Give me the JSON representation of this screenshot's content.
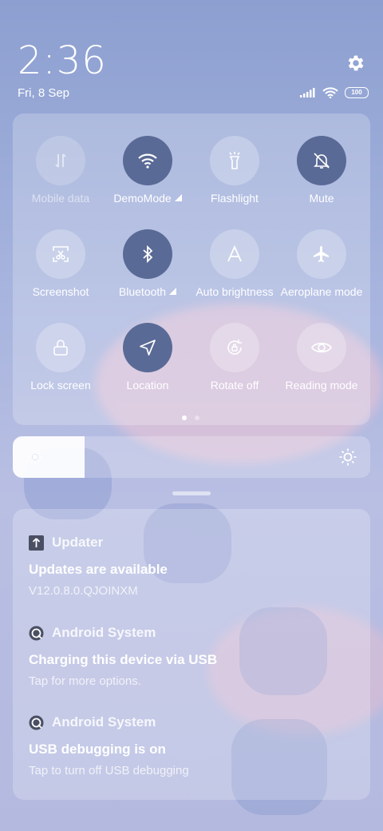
{
  "status": {
    "time": "2:36",
    "date": "Fri, 8 Sep",
    "battery": "100"
  },
  "tiles": [
    {
      "label": "Mobile data",
      "icon": "mobile-data-icon",
      "state": "disabled"
    },
    {
      "label": "DemoMode",
      "icon": "wifi-icon",
      "state": "active",
      "expandable": true
    },
    {
      "label": "Flashlight",
      "icon": "flashlight-icon",
      "state": "off"
    },
    {
      "label": "Mute",
      "icon": "bell-mute-icon",
      "state": "active"
    },
    {
      "label": "Screenshot",
      "icon": "screenshot-icon",
      "state": "off"
    },
    {
      "label": "Bluetooth",
      "icon": "bluetooth-icon",
      "state": "active",
      "expandable": true
    },
    {
      "label": "Auto brightness",
      "icon": "auto-brightness-icon",
      "state": "off"
    },
    {
      "label": "Aeroplane mode",
      "icon": "airplane-icon",
      "state": "off"
    },
    {
      "label": "Lock screen",
      "icon": "lock-icon",
      "state": "off"
    },
    {
      "label": "Location",
      "icon": "location-icon",
      "state": "active"
    },
    {
      "label": "Rotate off",
      "icon": "rotate-lock-icon",
      "state": "off"
    },
    {
      "label": "Reading mode",
      "icon": "eye-icon",
      "state": "off"
    }
  ],
  "pager": {
    "pages": 2,
    "current": 1
  },
  "brightness": {
    "level": 0.2
  },
  "notifications": [
    {
      "app": "Updater",
      "icon": "updater-icon",
      "title": "Updates are available",
      "body": "V12.0.8.0.QJOINXM"
    },
    {
      "app": "Android System",
      "icon": "android-system-icon",
      "title": "Charging this device via USB",
      "body": "Tap for more options."
    },
    {
      "app": "Android System",
      "icon": "android-system-icon",
      "title": "USB debugging is on",
      "body": "Tap to turn off USB debugging"
    }
  ],
  "colors": {
    "accent_active": "#5a6a96"
  }
}
